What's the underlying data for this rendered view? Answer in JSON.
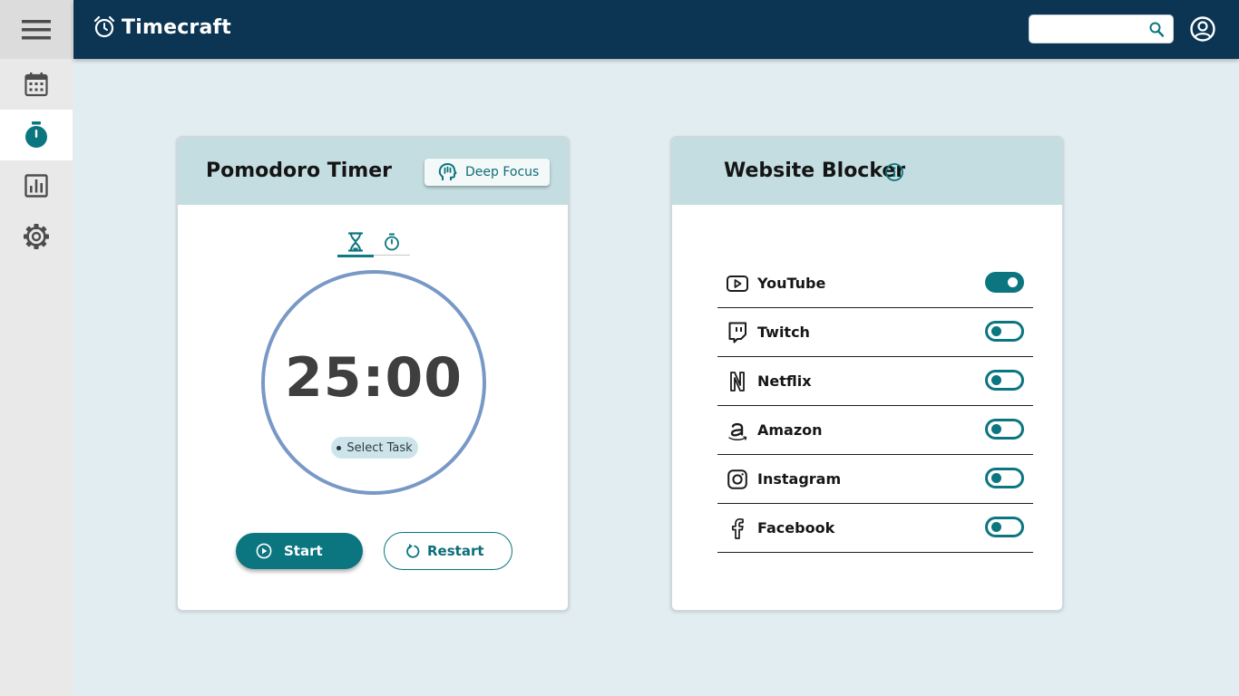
{
  "app": {
    "title": "Timecraft"
  },
  "sidebar": {
    "items": [
      {
        "name": "menu",
        "icon": "hamburger-menu-icon"
      },
      {
        "name": "calendar",
        "icon": "calendar-icon"
      },
      {
        "name": "timer",
        "icon": "stopwatch-icon",
        "active": true
      },
      {
        "name": "reports",
        "icon": "bar-chart-icon"
      },
      {
        "name": "settings",
        "icon": "gear-icon"
      }
    ]
  },
  "header": {
    "search": {
      "value": "",
      "placeholder": ""
    }
  },
  "pomodoro": {
    "title": "Pomodoro Timer",
    "deep_focus_label": "Deep Focus",
    "tabs": [
      {
        "icon": "hourglass-icon",
        "active": true
      },
      {
        "icon": "stopwatch-icon",
        "active": false
      }
    ],
    "time": "25:00",
    "task_label": "Select Task",
    "start_label": "Start",
    "restart_label": "Restart"
  },
  "blocker": {
    "title": "Website Blocker",
    "sites": [
      {
        "name": "YouTube",
        "icon": "youtube-icon",
        "enabled": true
      },
      {
        "name": "Twitch",
        "icon": "twitch-icon",
        "enabled": false
      },
      {
        "name": "Netflix",
        "icon": "netflix-icon",
        "enabled": false
      },
      {
        "name": "Amazon",
        "icon": "amazon-icon",
        "enabled": false
      },
      {
        "name": "Instagram",
        "icon": "instagram-icon",
        "enabled": false
      },
      {
        "name": "Facebook",
        "icon": "facebook-icon",
        "enabled": false
      }
    ]
  },
  "colors": {
    "header": "#0b3553",
    "accent": "#0b7580",
    "ring": "#7898c6",
    "card_header": "#c3dde0",
    "background": "#e2edf2"
  }
}
